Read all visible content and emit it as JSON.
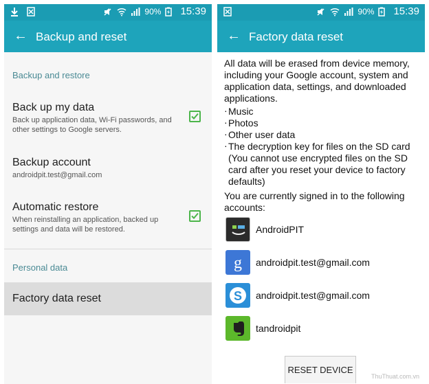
{
  "left": {
    "status": {
      "battery": "90%",
      "time": "15:39"
    },
    "appbar": {
      "title": "Backup and reset"
    },
    "sections": {
      "backup_header": "Backup and restore",
      "personal_header": "Personal data"
    },
    "items": {
      "backup_data_title": "Back up my data",
      "backup_data_desc": "Back up application data, Wi-Fi passwords, and other settings to Google servers.",
      "backup_account_title": "Backup account",
      "backup_account_value": "androidpit.test@gmail.com",
      "auto_restore_title": "Automatic restore",
      "auto_restore_desc": "When reinstalling an application, backed up settings and data will be restored.",
      "factory_reset": "Factory data reset"
    }
  },
  "right": {
    "status": {
      "battery": "90%",
      "time": "15:39"
    },
    "appbar": {
      "title": "Factory data reset"
    },
    "intro": "All data will be erased from device memory, including your Google account, system and application data, settings, and downloaded applications.",
    "bullets": [
      "Music",
      "Photos",
      "Other user data",
      "The decryption key for files on the SD card"
    ],
    "note": "(You cannot use encrypted files on the SD card after you reset your device to factory defaults)",
    "signed_in": "You are currently signed in to the following accounts:",
    "accounts": [
      {
        "name": "AndroidPIT",
        "icon": "androidpit-icon"
      },
      {
        "name": "androidpit.test@gmail.com",
        "icon": "google-icon"
      },
      {
        "name": "androidpit.test@gmail.com",
        "icon": "skype-icon"
      },
      {
        "name": "tandroidpit",
        "icon": "evernote-icon"
      }
    ],
    "reset_button": "RESET DEVICE",
    "watermark": "ThuThuat.com.vn"
  },
  "colors": {
    "statusbar": "#1b9cb3",
    "appbar": "#1ea4bb",
    "check": "#4cb54a",
    "section": "#4a8a94"
  }
}
